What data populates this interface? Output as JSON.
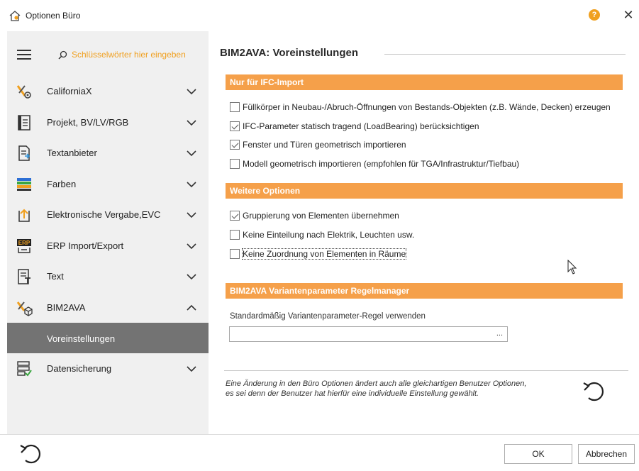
{
  "window": {
    "title": "Optionen Büro",
    "help_symbol": "?",
    "close_symbol": "✕"
  },
  "sidebar": {
    "search_placeholder": "Schlüsselwörter hier eingeben",
    "items": [
      {
        "label": "CaliforniaX",
        "icon": "californiax-icon",
        "expanded": false
      },
      {
        "label": "Projekt, BV/LV/RGB",
        "icon": "project-document-icon",
        "expanded": false
      },
      {
        "label": "Textanbieter",
        "icon": "text-provider-icon",
        "expanded": false
      },
      {
        "label": "Farben",
        "icon": "colors-icon",
        "expanded": false
      },
      {
        "label": "Elektronische Vergabe,EVC",
        "icon": "upload-icon",
        "expanded": false
      },
      {
        "label": "ERP Import/Export",
        "icon": "erp-icon",
        "expanded": false
      },
      {
        "label": "Text",
        "icon": "text-format-icon",
        "expanded": false
      },
      {
        "label": "BIM2AVA",
        "icon": "bim2ava-icon",
        "expanded": true
      },
      {
        "label": "Voreinstellungen",
        "sub": true,
        "selected": true
      },
      {
        "label": "Datensicherung",
        "icon": "backup-icon",
        "expanded": false
      }
    ]
  },
  "main": {
    "title": "BIM2AVA: Voreinstellungen",
    "sections": [
      {
        "header": "Nur für IFC-Import",
        "options": [
          {
            "label": "Füllkörper in Neubau-/Abruch-Öffnungen von Bestands-Objekten (z.B. Wände, Decken) erzeugen",
            "checked": false
          },
          {
            "label": "IFC-Parameter statisch tragend (LoadBearing) berücksichtigen",
            "checked": true
          },
          {
            "label": "Fenster und Türen geometrisch importieren",
            "checked": true
          },
          {
            "label": "Modell geometrisch importieren (empfohlen für TGA/Infrastruktur/Tiefbau)",
            "checked": false
          }
        ]
      },
      {
        "header": "Weitere Optionen",
        "options": [
          {
            "label": "Gruppierung von Elementen übernehmen",
            "checked": true
          },
          {
            "label": "Keine Einteilung nach Elektrik, Leuchten usw.",
            "checked": false
          },
          {
            "label": "Keine Zuordnung von Elementen in Räume",
            "checked": false,
            "focused": true
          }
        ]
      },
      {
        "header": "BIM2AVA Variantenparameter Regelmanager",
        "field_label": "Standardmäßig Variantenparameter-Regel verwenden",
        "field_value": "",
        "browse_label": "..."
      }
    ],
    "note_line1": "Eine Änderung in den Büro Optionen ändert auch alle gleichartigen Benutzer Optionen,",
    "note_line2": "es sei denn der Benutzer hat hierfür eine individuelle Einstellung gewählt."
  },
  "footer": {
    "ok_label": "OK",
    "cancel_label": "Abbrechen"
  },
  "colors": {
    "accent": "#f5a04a",
    "search_text": "#f0a020",
    "sidebar_bg": "#f0f0f0",
    "selected_bg": "#737373"
  }
}
